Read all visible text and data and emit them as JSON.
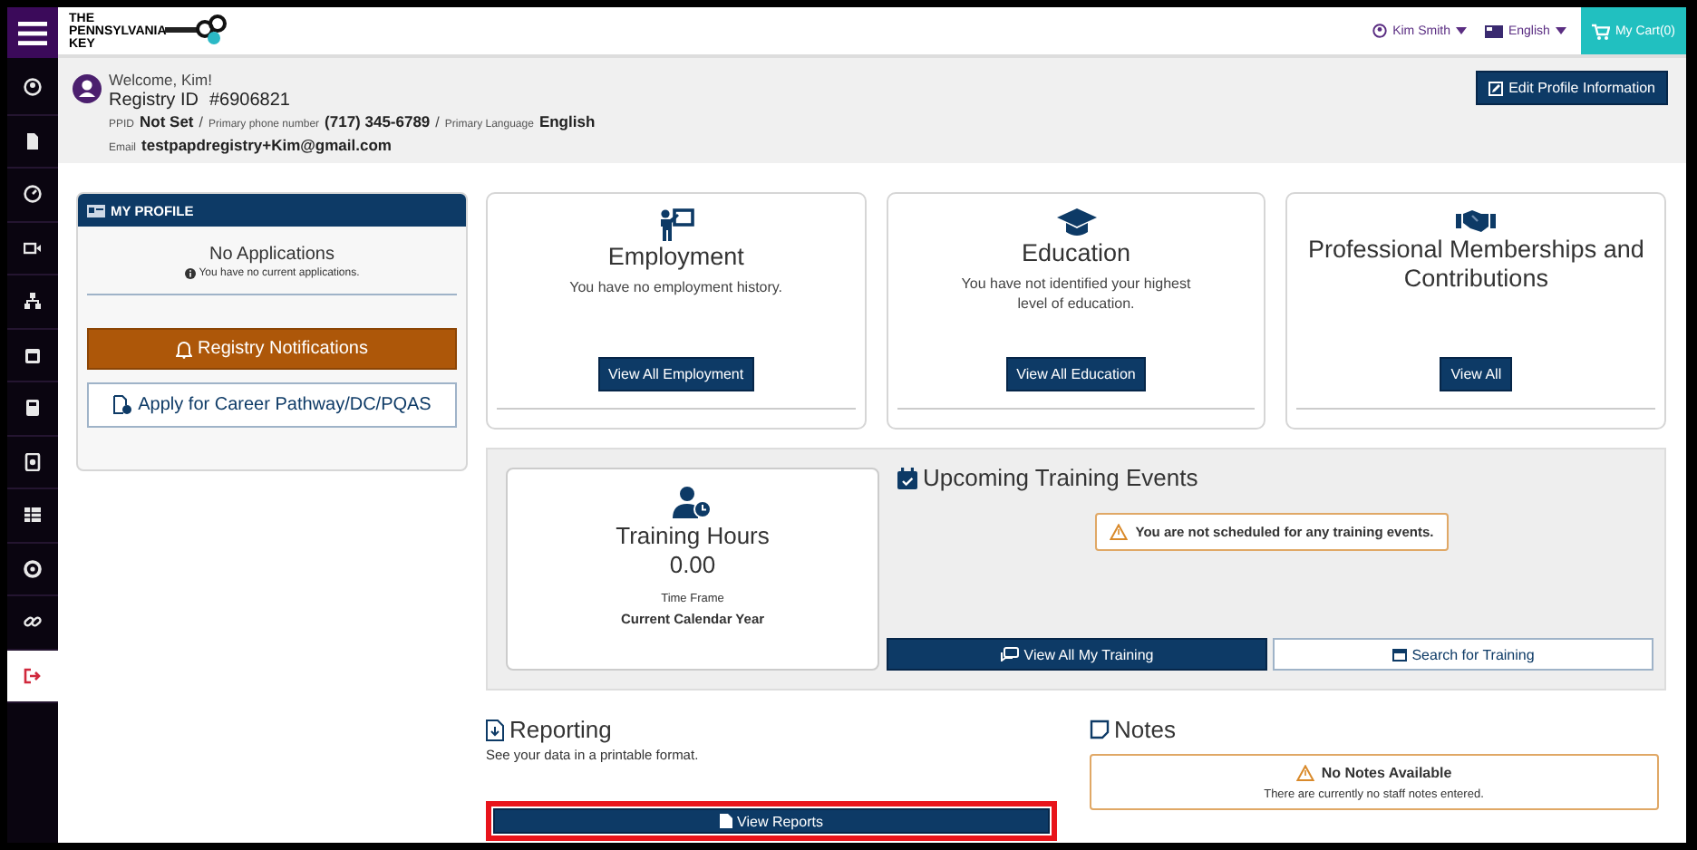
{
  "top_bar": {
    "logo_text": "THE PENNSYLVANIA KEY",
    "user_menu": "Kim Smith",
    "language_menu": "English",
    "cart": "My Cart(0)"
  },
  "sidebar": {
    "items": [
      {
        "kind": "user",
        "selected": false
      },
      {
        "kind": "document",
        "selected": false
      },
      {
        "kind": "gauge",
        "selected": false
      },
      {
        "kind": "video",
        "selected": false
      },
      {
        "kind": "sitemap",
        "selected": false
      },
      {
        "kind": "calendar",
        "selected": false
      },
      {
        "kind": "book",
        "selected": false
      },
      {
        "kind": "badge",
        "selected": false
      },
      {
        "kind": "table",
        "selected": false
      },
      {
        "kind": "lifebuoy",
        "selected": false
      },
      {
        "kind": "link",
        "selected": false
      },
      {
        "kind": "logout",
        "selected": true
      }
    ]
  },
  "header": {
    "welcome": "Welcome, Kim!",
    "registry_label": "Registry ID",
    "registry_id": "#6906821",
    "ppid_label": "PPID",
    "ppid": "Not Set",
    "separator": "/",
    "phone_label": "Primary phone number",
    "phone": "(717) 345-6789",
    "language_label": "Primary Language",
    "language": "English",
    "email_label": "Email",
    "email": "testpapdregistry+Kim@gmail.com",
    "edit_button": "Edit Profile Information"
  },
  "my_profile": {
    "title": "MY PROFILE",
    "applications_title": "No Applications",
    "applications_note": "You have no current applications.",
    "notifications_button": "Registry Notifications",
    "apply_button": "Apply for Career Pathway/DC/PQAS"
  },
  "cards": [
    {
      "kind": "employment",
      "title": "Employment",
      "text": "You have no employment history.",
      "button": "View All Employment"
    },
    {
      "kind": "education",
      "title": "Education",
      "text": "You have not identified your highest level of education.",
      "button": "View All Education"
    },
    {
      "kind": "memberships",
      "title": "Professional Memberships and Contributions",
      "button": "View All"
    }
  ],
  "training": {
    "hours_title": "Training Hours",
    "hours": "0.00",
    "time_frame_label": "Time Frame",
    "time_frame": "Current Calendar Year",
    "events_title": "Upcoming Training Events",
    "events_alert": "You are not scheduled for any training events.",
    "view_button": "View All My Training",
    "search_button": "Search for Training"
  },
  "reporting": {
    "title": "Reporting",
    "text": "See your data in a printable format.",
    "button": "View Reports",
    "highlighted": true
  },
  "notes": {
    "title": "Notes",
    "alert_title": "No Notes Available",
    "alert_text": "There are currently no staff notes entered."
  }
}
